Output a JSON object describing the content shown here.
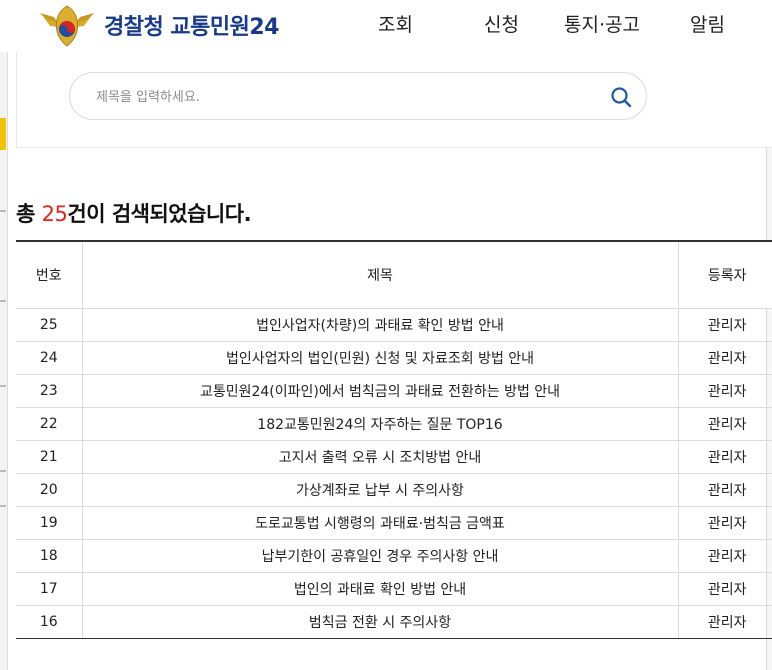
{
  "header": {
    "brand": "경찰청 교통민원24",
    "nav": [
      "조회",
      "신청",
      "통지·공고",
      "알림"
    ]
  },
  "search": {
    "placeholder": "제목을 입력하세요."
  },
  "result": {
    "prefix": "총 ",
    "count": "25",
    "suffix": "건이 검색되었습니다."
  },
  "table": {
    "headers": [
      "번호",
      "제목",
      "등록자"
    ],
    "rows": [
      {
        "no": "25",
        "title": "법인사업자(차량)의 과태료 확인 방법 안내",
        "author": "관리자"
      },
      {
        "no": "24",
        "title": "법인사업자의 법인(민원) 신청 및 자료조회 방법 안내",
        "author": "관리자"
      },
      {
        "no": "23",
        "title": "교통민원24(이파인)에서 범칙금의 과태료 전환하는 방법 안내",
        "author": "관리자"
      },
      {
        "no": "22",
        "title": "182교통민원24의 자주하는 질문 TOP16",
        "author": "관리자"
      },
      {
        "no": "21",
        "title": "고지서 출력 오류 시 조치방법 안내",
        "author": "관리자"
      },
      {
        "no": "20",
        "title": "가상계좌로 납부 시 주의사항",
        "author": "관리자"
      },
      {
        "no": "19",
        "title": "도로교통법 시행령의 과태료·범칙금 금액표",
        "author": "관리자"
      },
      {
        "no": "18",
        "title": "납부기한이 공휴일인 경우 주의사항 안내",
        "author": "관리자"
      },
      {
        "no": "17",
        "title": "법인의 과태료 확인 방법 안내",
        "author": "관리자"
      },
      {
        "no": "16",
        "title": "범칙금 전환 시 주의사항",
        "author": "관리자"
      }
    ]
  },
  "colors": {
    "brand": "#173a8c",
    "count": "#e1251b"
  },
  "icons": {
    "emblem": "police-emblem-icon",
    "search": "search-icon"
  }
}
